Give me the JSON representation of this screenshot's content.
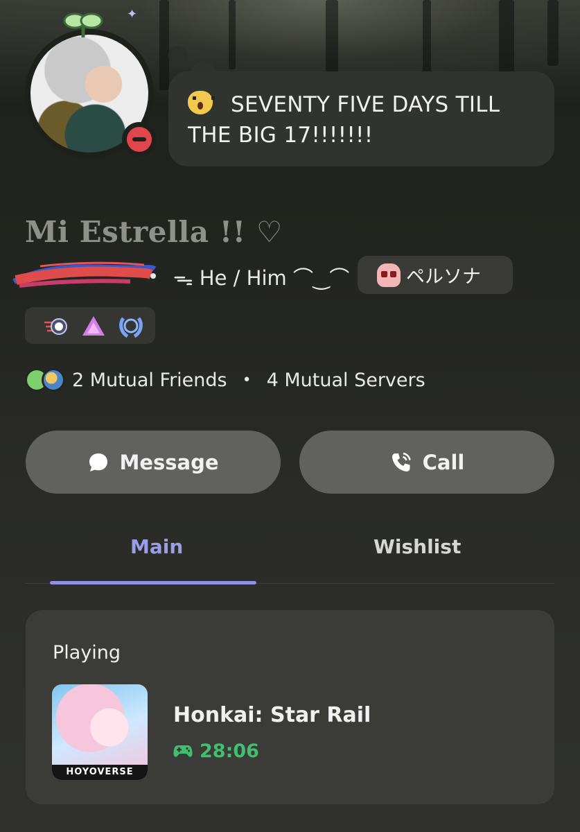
{
  "profile": {
    "status_text": "SEVENTY FIVE DAYS TILL THE BIG 17!!!!!!!",
    "status_emoji": "astonished-cat-icon",
    "display_name": "Mi Estrella !! ♡",
    "pronouns": "ᯓ He / Him ⌒‿⌒",
    "tag": "ペルソナ",
    "presence": "do-not-disturb"
  },
  "badges": [
    "nitro-orb-icon",
    "boost-triangle-icon",
    "laurel-badge-icon"
  ],
  "mutuals": {
    "friends": "2 Mutual Friends",
    "separator": "•",
    "servers": "4 Mutual Servers"
  },
  "actions": {
    "message_label": "Message",
    "call_label": "Call"
  },
  "tabs": [
    {
      "label": "Main",
      "active": true
    },
    {
      "label": "Wishlist",
      "active": false
    }
  ],
  "activity": {
    "heading": "Playing",
    "game_name": "Honkai: Star Rail",
    "elapsed": "28:06",
    "art_logo": "HOYOVERSE"
  },
  "colors": {
    "accent": "#8e92e0",
    "dnd": "#e0464b",
    "playing_time": "#3fbf6f"
  }
}
